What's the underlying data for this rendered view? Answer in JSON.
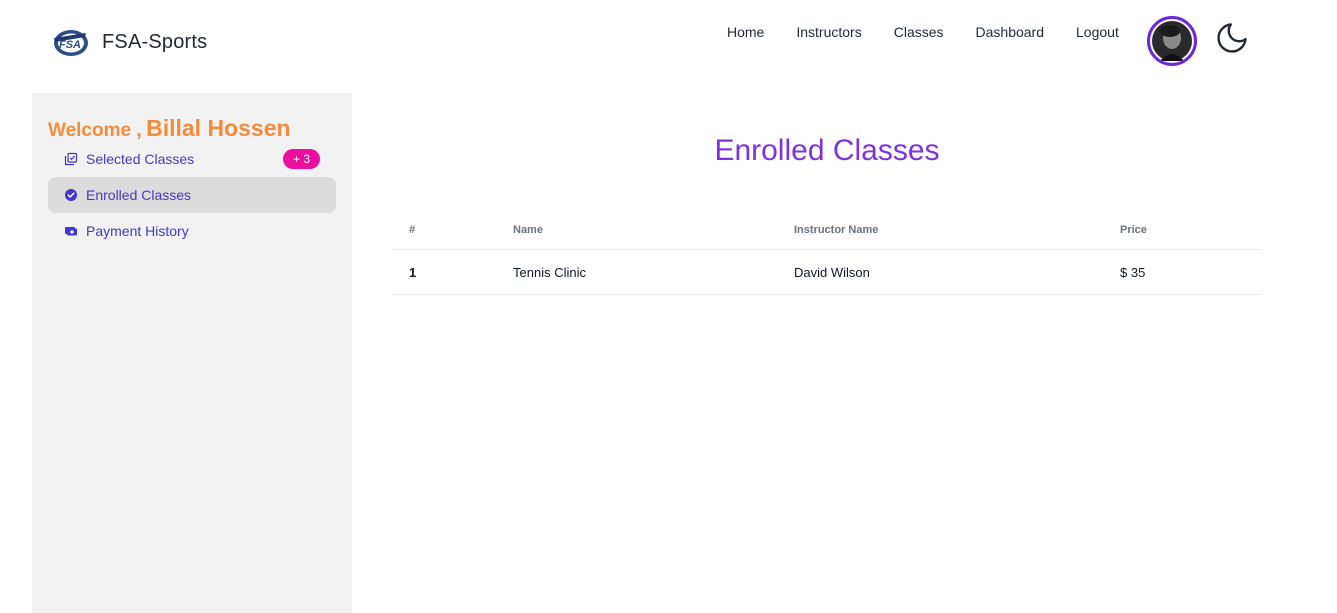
{
  "brand": {
    "name": "FSA-Sports",
    "logo_text": "FSA"
  },
  "nav": {
    "links": [
      "Home",
      "Instructors",
      "Classes",
      "Dashboard",
      "Logout"
    ]
  },
  "sidebar": {
    "welcome_label": "Welcome ,",
    "user_name": "Billal Hossen",
    "items": [
      {
        "label": "Selected Classes",
        "icon": "selected-classes-icon",
        "badge": "+ 3"
      },
      {
        "label": "Enrolled Classes",
        "icon": "check-circle-icon",
        "active": true
      },
      {
        "label": "Payment History",
        "icon": "payment-icon"
      }
    ]
  },
  "main": {
    "title": "Enrolled Classes",
    "table": {
      "headers": [
        "#",
        "Name",
        "Instructor Name",
        "Price"
      ],
      "rows": [
        [
          "1",
          "Tennis Clinic",
          "David Wilson",
          "$ 35"
        ]
      ]
    }
  },
  "colors": {
    "accent_purple": "#7e32e0",
    "welcome_orange": "#f48c3c",
    "badge_pink": "#ec0f9f",
    "menu_indigo": "#4338ca",
    "avatar_ring": "#6d28d9"
  }
}
